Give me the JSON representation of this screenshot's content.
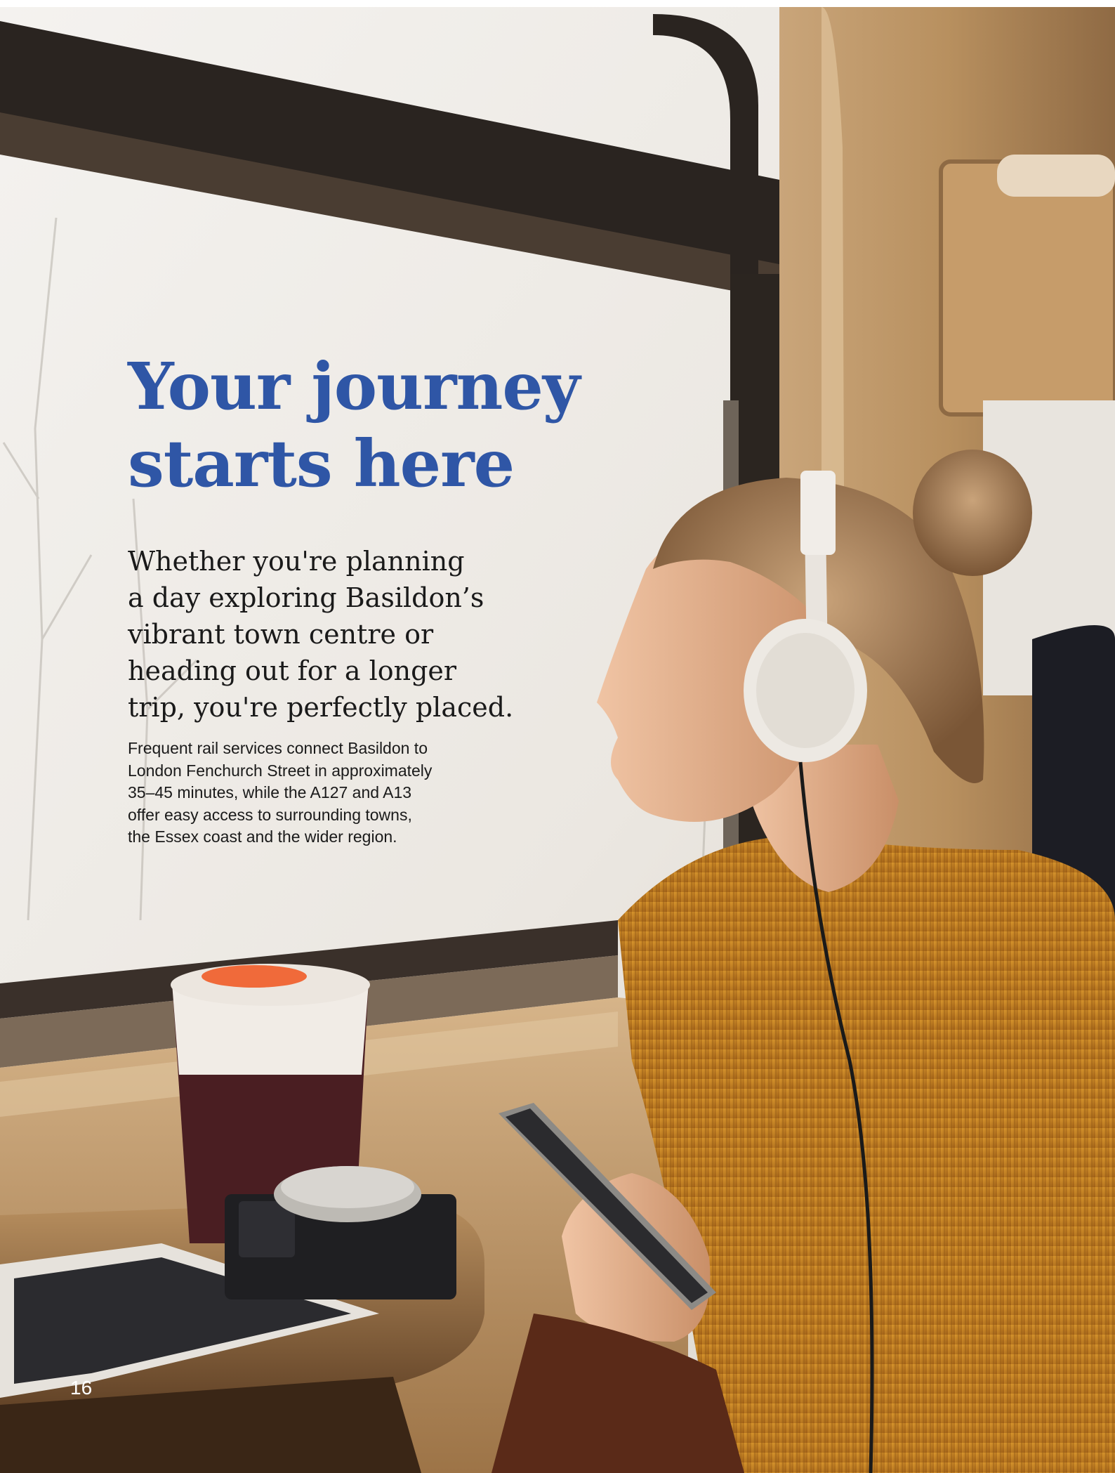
{
  "headline": {
    "line1": "Your journey",
    "line2": "starts here"
  },
  "lead": {
    "line1": "Whether you're planning",
    "line2": "a day exploring Basildon’s",
    "line3": "vibrant town centre or",
    "line4": "heading out for a longer",
    "line5": "trip, you're perfectly placed."
  },
  "body": {
    "line1": "Frequent rail services connect Basildon to",
    "line2": "London Fenchurch Street in approximately",
    "line3": "35–45 minutes, while the A127 and A13",
    "line4": "offer easy access to surrounding towns,",
    "line5": "the Essex coast and the wider region."
  },
  "page_number": "16",
  "colors": {
    "headline": "#2f56a6",
    "text": "#1a1a1a",
    "page_number": "#ffffff"
  }
}
